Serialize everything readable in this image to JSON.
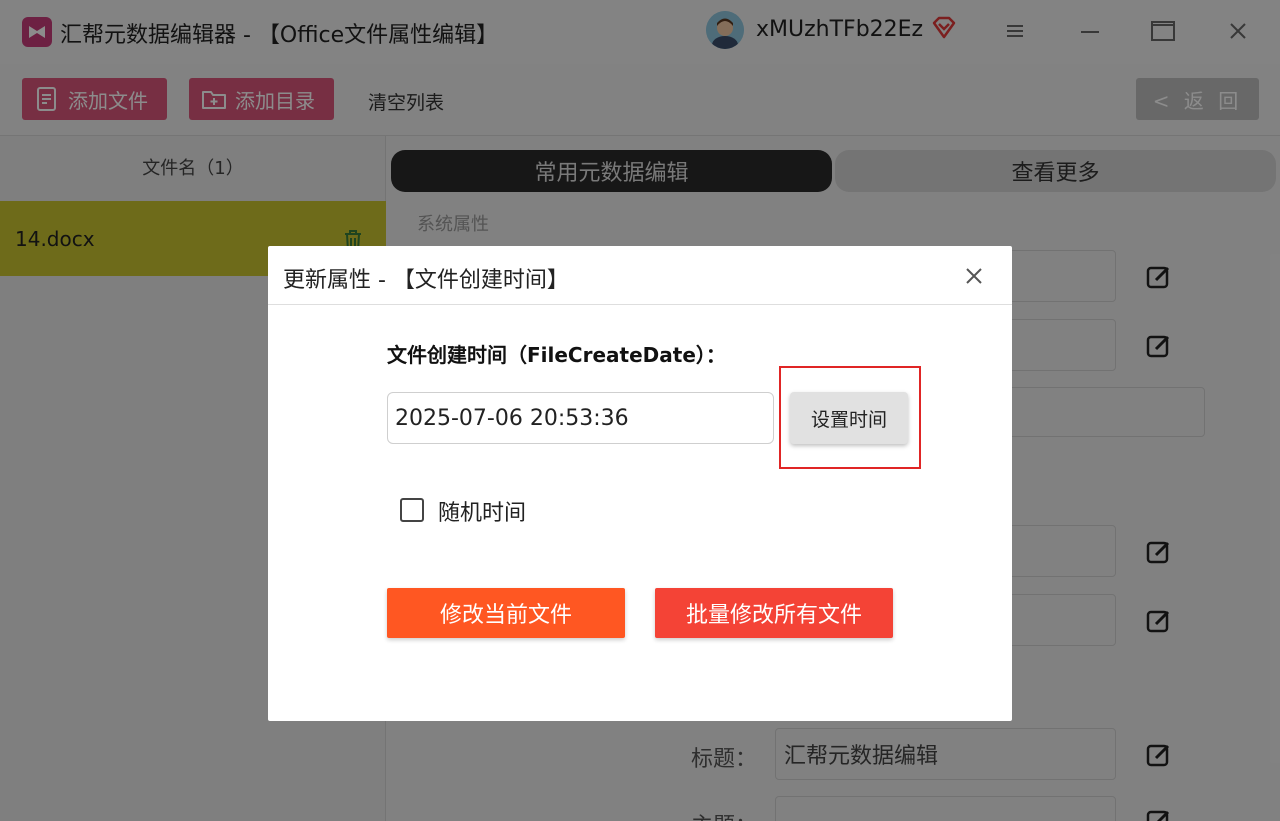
{
  "app": {
    "title": "汇帮元数据编辑器 - 【Office文件属性编辑】",
    "username": "xMUzhTFb22Ez"
  },
  "icons": {
    "logo": "app-logo-icon",
    "vip": "vip-diamond-icon",
    "menu": "hamburger-menu-icon",
    "minimize": "minimize-icon",
    "maximize": "maximize-icon",
    "close": "close-icon"
  },
  "colors": {
    "accent_pink": "#d9577a",
    "selected_row": "#c8c330",
    "primary_orange": "#ff5722",
    "primary_red": "#f44336",
    "highlight": "#e02525"
  },
  "toolbar": {
    "add_file": "添加文件",
    "add_dir": "添加目录",
    "clear_list": "清空列表",
    "back": "< 返 回"
  },
  "file_list": {
    "header": "文件名（1）",
    "files": [
      {
        "name": "14.docx"
      }
    ]
  },
  "tabs": {
    "common": "常用元数据编辑",
    "more": "查看更多"
  },
  "properties": {
    "section_system": "系统属性",
    "title_label": "标题：",
    "title_value": "汇帮元数据编辑",
    "subject_label": "主题："
  },
  "dialog": {
    "title": "更新属性 - 【文件创建时间】",
    "field_label": "文件创建时间（FileCreateDate）：",
    "date_value": "2025-07-06 20:53:36",
    "set_time": "设置时间",
    "random_time": "随机时间",
    "random_checked": false,
    "modify_current": "修改当前文件",
    "batch_modify": "批量修改所有文件"
  }
}
